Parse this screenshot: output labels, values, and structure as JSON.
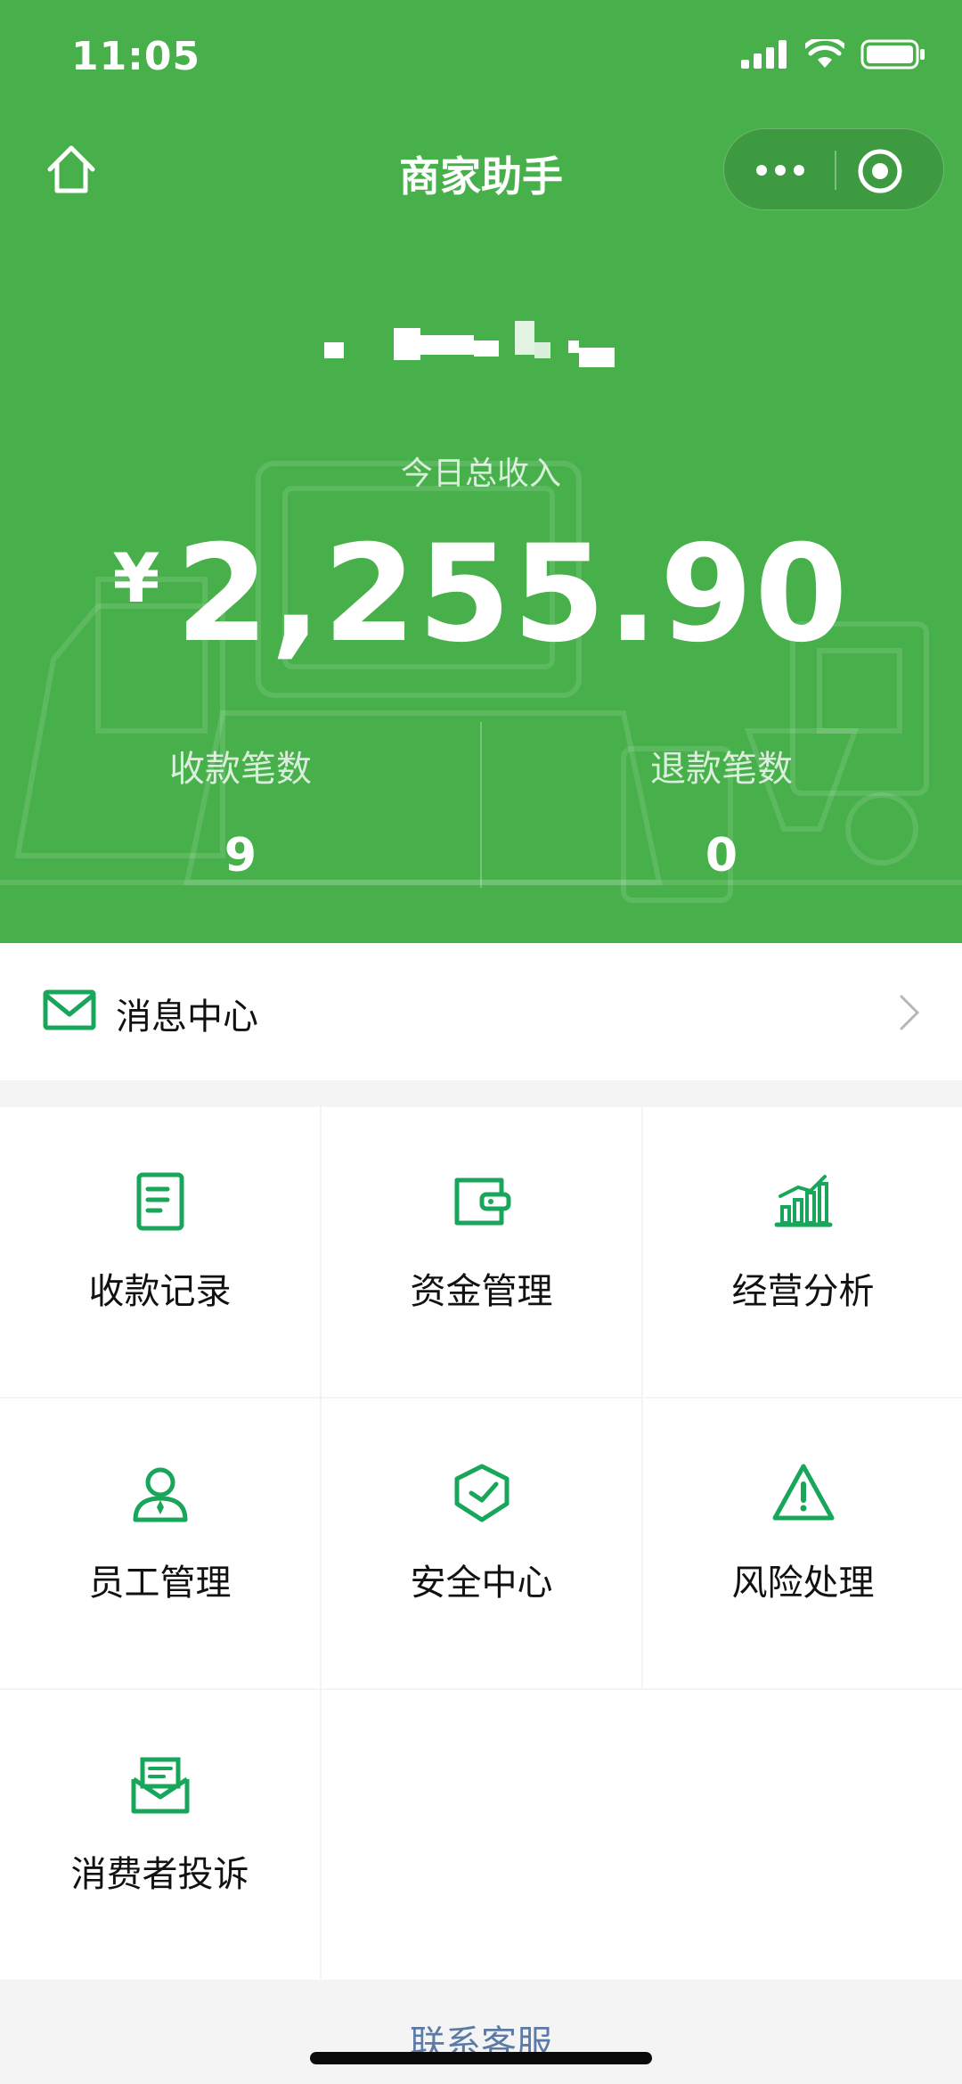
{
  "status_bar": {
    "time": "11:05"
  },
  "nav": {
    "title": "商家助手"
  },
  "summary": {
    "income_label": "今日总收入",
    "currency": "¥",
    "income_value": "2,255.90",
    "receipts_label": "收款笔数",
    "receipts_count": "9",
    "refunds_label": "退款笔数",
    "refunds_count": "0"
  },
  "message_center": {
    "label": "消息中心"
  },
  "menu": {
    "items": [
      {
        "label": "收款记录",
        "icon": "receipt-icon"
      },
      {
        "label": "资金管理",
        "icon": "wallet-icon"
      },
      {
        "label": "经营分析",
        "icon": "bar-chart-icon"
      },
      {
        "label": "员工管理",
        "icon": "staff-icon"
      },
      {
        "label": "安全中心",
        "icon": "shield-icon"
      },
      {
        "label": "风险处理",
        "icon": "warning-icon"
      },
      {
        "label": "消费者投诉",
        "icon": "complaint-envelope-icon"
      }
    ]
  },
  "footer": {
    "contact_label": "联系客服"
  },
  "colors": {
    "brand_green": "#47b04a",
    "icon_green": "#18a65a",
    "link_blue": "#5c7aa8"
  }
}
